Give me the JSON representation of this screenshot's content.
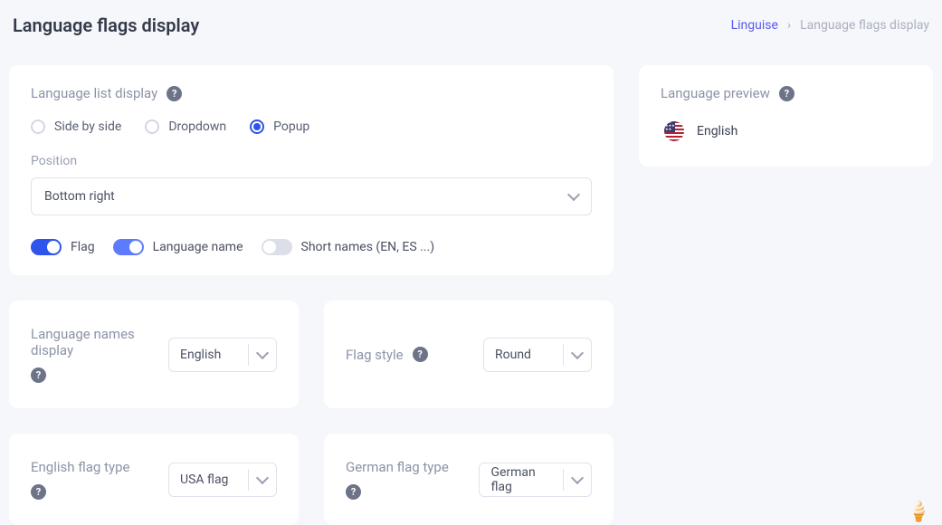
{
  "header": {
    "title": "Language flags display",
    "breadcrumb_link": "Linguise",
    "breadcrumb_current": "Language flags display"
  },
  "main": {
    "section_label": "Language list display",
    "radio": {
      "side_by_side": "Side by side",
      "dropdown": "Dropdown",
      "popup": "Popup",
      "selected": "popup"
    },
    "position_label": "Position",
    "position_value": "Bottom right",
    "toggles": {
      "flag": {
        "label": "Flag",
        "on": true
      },
      "language_name": {
        "label": "Language name",
        "on": true
      },
      "short_names": {
        "label": "Short names (EN, ES ...)",
        "on": false
      }
    }
  },
  "cards": {
    "names_display": {
      "label": "Language names display",
      "value": "English"
    },
    "flag_style": {
      "label": "Flag style",
      "value": "Round"
    },
    "english_flag": {
      "label": "English flag type",
      "value": "USA flag"
    },
    "german_flag": {
      "label": "German flag type",
      "value": "German flag"
    }
  },
  "preview": {
    "label": "Language preview",
    "language": "English"
  }
}
